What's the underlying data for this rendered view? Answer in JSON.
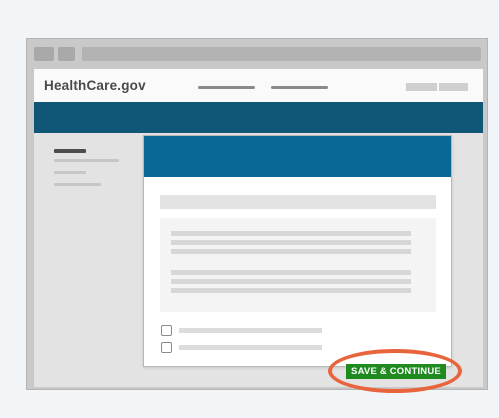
{
  "site": {
    "logo_text": "HealthCare.gov"
  },
  "modal": {
    "save_button_label": "SAVE & CONTINUE"
  },
  "colors": {
    "site_band": "#0f5677",
    "modal_header": "#0a6896",
    "primary_button": "#1f8a1f",
    "highlight_ring": "#e8643c"
  }
}
